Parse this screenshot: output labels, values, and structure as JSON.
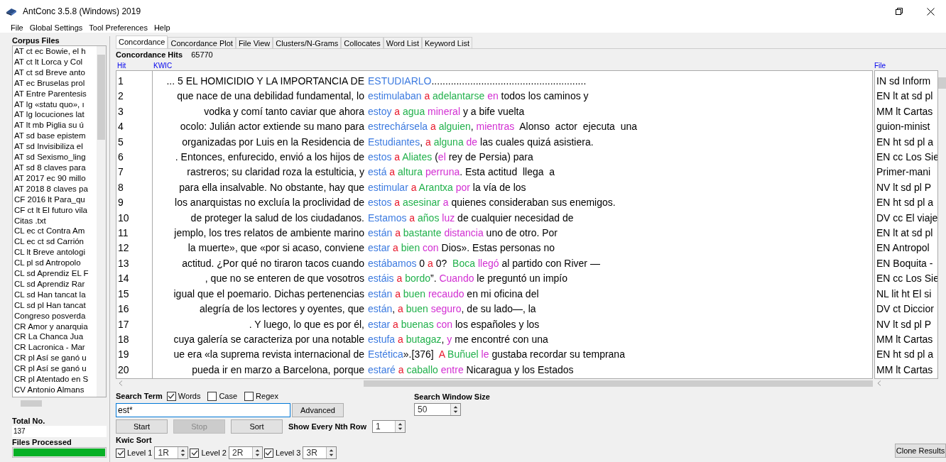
{
  "window": {
    "title": "AntConc 3.5.8 (Windows) 2019"
  },
  "menu": [
    "File",
    "Global Settings",
    "Tool Preferences",
    "Help"
  ],
  "corpus_files": {
    "heading": "Corpus Files",
    "items": [
      "AT ct ec Bowie, el h",
      "AT ct lt  Lorca y Col",
      "AT ct sd Breve anto",
      "AT ec Bruselas prol",
      "AT Entre Parentesis",
      "AT lg «statu quo», ı",
      "AT lg locuciones lat",
      "AT lt mb Piglia su ú",
      "AT sd base epistem",
      "AT sd Invisibiliza el",
      "AT sd Sexismo_ling",
      "AT sd 8 claves para",
      "AT 2017 ec 90 millo",
      "AT 2018 8 claves pa",
      "CF  2016 lt Para_qu",
      "CF ct lt El futuro vila",
      "Citas .txt",
      "CL ec ct Contra Am",
      "CL ec ct sd Carrión",
      "CL lt Breve antologi",
      "CL pl sd Antropolo",
      "CL sd Aprendiz EL F",
      "CL sd Aprendiz Rar",
      "CL sd Han tancat la",
      "CL sd pl Han tancat",
      "Congreso posverda",
      "CR Amor y anarquia",
      "CR La Chanca    Jua",
      "CR Lacronica - Mar",
      "CR pl Así se ganó u",
      "CR pl Así se ganó u",
      "CR pl Atentado en S",
      "CV Antonio Almans"
    ]
  },
  "total": {
    "label": "Total No.",
    "value": "137"
  },
  "files_processed": {
    "label": "Files Processed",
    "level": 1
  },
  "tabs": [
    {
      "label": "Concordance",
      "selected": true
    },
    {
      "label": "Concordance Plot",
      "selected": false
    },
    {
      "label": "File View",
      "selected": false
    },
    {
      "label": "Clusters/N-Grams",
      "selected": false
    },
    {
      "label": "Collocates",
      "selected": false
    },
    {
      "label": "Word List",
      "selected": false
    },
    {
      "label": "Keyword List",
      "selected": false
    }
  ],
  "concordance": {
    "hits_label": "Concordance Hits",
    "hits_value": "65770",
    "columns": [
      "Hit",
      "KWIC",
      "File"
    ],
    "rows": [
      {
        "hit": "1",
        "left": "... 5  EL HOMICIDIO Y LA IMPORTANCIA DE",
        "right": [
          {
            "text": "ESTUDIARLO",
            "color": "#3d7be0"
          },
          {
            "text": "........................................................"
          }
        ],
        "file": "IN sd Inform"
      },
      {
        "hit": "2",
        "left": "que nace de una debilidad fundamental, lo",
        "right": [
          {
            "text": "estimulaban ",
            "color": "#3d7be0"
          },
          {
            "text": "a ",
            "color": "#e8192c"
          },
          {
            "text": "adelantarse ",
            "color": "#22b14c"
          },
          {
            "text": "en",
            "color": "#d22fd2"
          },
          {
            "text": " todos los caminos y"
          }
        ],
        "file": "EN lt at sd pl"
      },
      {
        "hit": "3",
        "left": "vodka y comí tanto caviar que ahora",
        "right": [
          {
            "text": "estoy ",
            "color": "#3d7be0"
          },
          {
            "text": "a ",
            "color": "#e8192c"
          },
          {
            "text": "agua ",
            "color": "#22b14c"
          },
          {
            "text": "mineral",
            "color": "#d22fd2"
          },
          {
            "text": " y a bife vuelta"
          }
        ],
        "file": "MM lt Cartas"
      },
      {
        "hit": "4",
        "left": "ocolo:  Julián  actor  extiende su mano para",
        "right": [
          {
            "text": "estrechársela ",
            "color": "#3d7be0"
          },
          {
            "text": "a ",
            "color": "#e8192c"
          },
          {
            "text": "alguien",
            "color": "#22b14c"
          },
          {
            "text": ", "
          },
          {
            "text": "mientras",
            "color": "#d22fd2"
          },
          {
            "text": "  Alonso  actor  ejecuta  una"
          }
        ],
        "file": "guion-minist"
      },
      {
        "hit": "5",
        "left": "organizadas por Luis en la Residencia de",
        "right": [
          {
            "text": "Estudiantes",
            "color": "#3d7be0"
          },
          {
            "text": ", "
          },
          {
            "text": "a ",
            "color": "#e8192c"
          },
          {
            "text": "alguna ",
            "color": "#22b14c"
          },
          {
            "text": "de",
            "color": "#d22fd2"
          },
          {
            "text": " las cuales quizá asistiera."
          }
        ],
        "file": "EN ht sd pl a"
      },
      {
        "hit": "6",
        "left": ". Entonces, enfurecido, envió a los hijos de",
        "right": [
          {
            "text": "estos ",
            "color": "#3d7be0"
          },
          {
            "text": "a ",
            "color": "#e8192c"
          },
          {
            "text": "Aliates",
            "color": "#22b14c"
          },
          {
            "text": " ("
          },
          {
            "text": "el",
            "color": "#d22fd2"
          },
          {
            "text": " rey de Persia) para"
          }
        ],
        "file": "EN cc Los Sie"
      },
      {
        "hit": "7",
        "left": "rastreros; su claridad roza la estulticia, y",
        "right": [
          {
            "text": "está ",
            "color": "#3d7be0"
          },
          {
            "text": "a ",
            "color": "#e8192c"
          },
          {
            "text": "altura ",
            "color": "#22b14c"
          },
          {
            "text": "perruna",
            "color": "#d22fd2"
          },
          {
            "text": ". Esta actitud  llega  a"
          }
        ],
        "file": "Primer-mani"
      },
      {
        "hit": "8",
        "left": "para ella insalvable. No obstante, hay que",
        "right": [
          {
            "text": "estimular ",
            "color": "#3d7be0"
          },
          {
            "text": "a ",
            "color": "#e8192c"
          },
          {
            "text": "Arantxa ",
            "color": "#22b14c"
          },
          {
            "text": "por",
            "color": "#d22fd2"
          },
          {
            "text": " la vía de los"
          }
        ],
        "file": "NV lt sd pl P"
      },
      {
        "hit": "9",
        "left": "los anarquistas no excluía la proclividad de",
        "right": [
          {
            "text": "estos ",
            "color": "#3d7be0"
          },
          {
            "text": "a ",
            "color": "#e8192c"
          },
          {
            "text": "asesinar ",
            "color": "#22b14c"
          },
          {
            "text": "a",
            "color": "#d22fd2"
          },
          {
            "text": " quienes consideraban sus enemigos."
          }
        ],
        "file": "EN ht sd pl a"
      },
      {
        "hit": "10",
        "left": "de proteger la salud de los ciudadanos.",
        "right": [
          {
            "text": "Estamos ",
            "color": "#3d7be0"
          },
          {
            "text": "a ",
            "color": "#e8192c"
          },
          {
            "text": "años ",
            "color": "#22b14c"
          },
          {
            "text": "luz",
            "color": "#d22fd2"
          },
          {
            "text": " de cualquier necesidad de"
          }
        ],
        "file": "DV cc El viaje"
      },
      {
        "hit": "11",
        "left": "jemplo, los tres relatos de ambiente marino",
        "right": [
          {
            "text": "están ",
            "color": "#3d7be0"
          },
          {
            "text": "a ",
            "color": "#e8192c"
          },
          {
            "text": "bastante ",
            "color": "#22b14c"
          },
          {
            "text": "distancia",
            "color": "#d22fd2"
          },
          {
            "text": " uno de otro. Por"
          }
        ],
        "file": "EN lt at sd pl"
      },
      {
        "hit": "12",
        "left": "la muerte», que «por si acaso, conviene",
        "right": [
          {
            "text": "estar ",
            "color": "#3d7be0"
          },
          {
            "text": "a ",
            "color": "#e8192c"
          },
          {
            "text": "bien ",
            "color": "#22b14c"
          },
          {
            "text": "con",
            "color": "#d22fd2"
          },
          {
            "text": " Dios». Estas personas no"
          }
        ],
        "file": "EN Antropol"
      },
      {
        "hit": "13",
        "left": "actitud. ¿Por qué no tiraron tacos cuando",
        "right": [
          {
            "text": "estábamos",
            "color": "#3d7be0"
          },
          {
            "text": " 0 "
          },
          {
            "text": "a",
            "color": "#e8192c"
          },
          {
            "text": " 0?  "
          },
          {
            "text": "Boca ",
            "color": "#22b14c"
          },
          {
            "text": "llegó",
            "color": "#d22fd2"
          },
          {
            "text": " al partido con River —"
          }
        ],
        "file": "EN Boquita -"
      },
      {
        "hit": "14",
        "left": ", que no se enteren de que vosotros",
        "right": [
          {
            "text": "estáis ",
            "color": "#3d7be0"
          },
          {
            "text": "a ",
            "color": "#e8192c"
          },
          {
            "text": "bordo",
            "color": "#22b14c"
          },
          {
            "text": "”. "
          },
          {
            "text": "Cuando",
            "color": "#d22fd2"
          },
          {
            "text": " le preguntó un impío"
          }
        ],
        "file": "EN cc Los Sie"
      },
      {
        "hit": "15",
        "left": "igual que el poemario. Dichas pertenencias",
        "right": [
          {
            "text": "están ",
            "color": "#3d7be0"
          },
          {
            "text": "a ",
            "color": "#e8192c"
          },
          {
            "text": "buen ",
            "color": "#22b14c"
          },
          {
            "text": "recaudo",
            "color": "#d22fd2"
          },
          {
            "text": " en mi oficina del"
          }
        ],
        "file": "NL lit ht El si"
      },
      {
        "hit": "16",
        "left": "alegría de los lectores y oyentes, que",
        "right": [
          {
            "text": "están",
            "color": "#3d7be0"
          },
          {
            "text": ", "
          },
          {
            "text": "a ",
            "color": "#e8192c"
          },
          {
            "text": "buen ",
            "color": "#22b14c"
          },
          {
            "text": "seguro",
            "color": "#d22fd2"
          },
          {
            "text": ", de su lado—, la"
          }
        ],
        "file": "DV ct Diccior"
      },
      {
        "hit": "17",
        "left": ". Y luego, lo que es por él,",
        "right": [
          {
            "text": "estar ",
            "color": "#3d7be0"
          },
          {
            "text": "a ",
            "color": "#e8192c"
          },
          {
            "text": "buenas ",
            "color": "#22b14c"
          },
          {
            "text": "con",
            "color": "#d22fd2"
          },
          {
            "text": " los españoles y los"
          }
        ],
        "file": "NV lt sd pl P"
      },
      {
        "hit": "18",
        "left": "cuya galería se caracteriza por una notable",
        "right": [
          {
            "text": "estufa ",
            "color": "#3d7be0"
          },
          {
            "text": "a ",
            "color": "#e8192c"
          },
          {
            "text": "butagaz",
            "color": "#22b14c"
          },
          {
            "text": ", "
          },
          {
            "text": "y",
            "color": "#d22fd2"
          },
          {
            "text": " me encontré con una"
          }
        ],
        "file": "MM lt Cartas"
      },
      {
        "hit": "19",
        "left": "ue era «la suprema revista internacional de",
        "right": [
          {
            "text": "Estética",
            "color": "#3d7be0"
          },
          {
            "text": "».[376]  "
          },
          {
            "text": "A ",
            "color": "#e8192c"
          },
          {
            "text": "Buñuel ",
            "color": "#22b14c"
          },
          {
            "text": "le",
            "color": "#d22fd2"
          },
          {
            "text": " gustaba recordar su temprana"
          }
        ],
        "file": "EN ht sd pl a"
      },
      {
        "hit": "20",
        "left": "pueda ir en marzo a Barcelona, porque",
        "right": [
          {
            "text": "estaré ",
            "color": "#3d7be0"
          },
          {
            "text": "a ",
            "color": "#e8192c"
          },
          {
            "text": "caballo ",
            "color": "#22b14c"
          },
          {
            "text": "entre",
            "color": "#d22fd2"
          },
          {
            "text": " Nicaragua y los Estados"
          }
        ],
        "file": "MM lt Cartas"
      }
    ]
  },
  "search": {
    "label": "Search Term",
    "options": [
      {
        "label": "Words",
        "checked": true
      },
      {
        "label": "Case",
        "checked": false
      },
      {
        "label": "Regex",
        "checked": false
      }
    ],
    "query": "est*",
    "advanced": "Advanced"
  },
  "buttons": [
    {
      "label": "Start",
      "disabled": false
    },
    {
      "label": "Stop",
      "disabled": true
    },
    {
      "label": "Sort",
      "disabled": false
    }
  ],
  "nth_row": {
    "label": "Show Every Nth Row",
    "value": "1"
  },
  "window_size": {
    "label": "Search Window Size",
    "value": "50"
  },
  "kwic_sort": {
    "label": "Kwic Sort",
    "levels": [
      {
        "label": "Level 1",
        "checked": true,
        "value": "1R"
      },
      {
        "label": "Level 2",
        "checked": true,
        "value": "2R"
      },
      {
        "label": "Level 3",
        "checked": true,
        "value": "3R"
      }
    ]
  },
  "clone": "Clone Results"
}
